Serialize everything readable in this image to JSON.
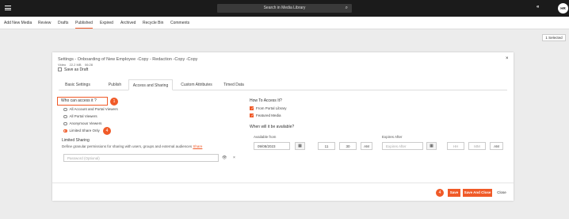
{
  "topbar": {
    "search_placeholder": "Search in Media Library",
    "avatar_initials": "HR"
  },
  "nav": {
    "items": [
      "Add New Media",
      "Review",
      "Drafts",
      "Published",
      "Expired",
      "Archived",
      "Recycle Bin",
      "Comments"
    ],
    "active": "Published"
  },
  "selection": {
    "label": "1 Selected"
  },
  "modal": {
    "title": "Settings - Onboarding of New Employee -Copy - Redaction -Copy -Copy",
    "meta_type": "Video",
    "meta_size": "22.2 MB",
    "meta_duration": "06:28",
    "save_as_draft": "Save as Draft",
    "tabs": [
      "Basic Settings",
      "Publish",
      "Access and Sharing",
      "Custom Attributes",
      "Timed Data"
    ],
    "active_tab": "Access and Sharing",
    "who_label": "Who can access it ?",
    "who_badge": "1",
    "options": [
      "All Account and Portal Viewers",
      "All Portal Viewers",
      "Anonymous Viewers",
      "Limited Share Only"
    ],
    "selected_option": "Limited Share Only",
    "option_badge": "4",
    "limited_title": "Limited Sharing",
    "limited_desc": "Define granular permissions for sharing with users, groups and external audiences",
    "share_link": "Share",
    "password_placeholder": "Password (Optional)",
    "how_title": "How To Access It?",
    "from_portal": "From Portal Library",
    "featured": "Featured Media",
    "when_title": "When will it be available?",
    "available_from": "Available from",
    "from_date": "09/08/2023",
    "from_hour": "11",
    "from_minute": "30",
    "from_ampm": "AM",
    "expires_after": "Expires After",
    "expire_placeholder": "Expires After",
    "exp_hour": "HH",
    "exp_minute": "MM",
    "exp_ampm": "AM",
    "footer_badge": "4",
    "save": "Save",
    "save_close": "Save And Close",
    "close": "Close"
  },
  "colors": {
    "accent": "#f05a28",
    "topbar": "#1b1b1b"
  }
}
